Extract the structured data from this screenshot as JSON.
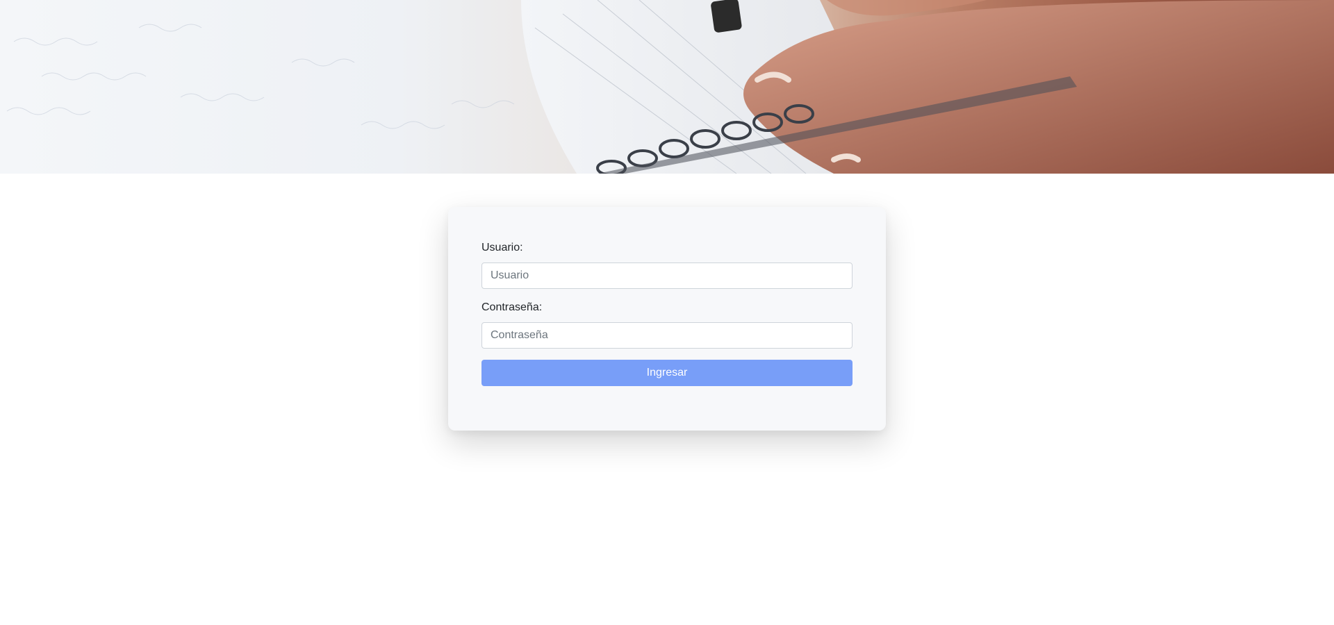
{
  "hero": {
    "image": "hands-writing-in-spiral-notebook"
  },
  "login": {
    "username_label": "Usuario:",
    "username_placeholder": "Usuario",
    "username_value": "",
    "password_label": "Contraseña:",
    "password_placeholder": "Contraseña",
    "password_value": "",
    "submit_label": "Ingresar"
  },
  "colors": {
    "button": "#789ef8",
    "card_background": "#f7f8fa",
    "input_border": "#ced4da"
  }
}
